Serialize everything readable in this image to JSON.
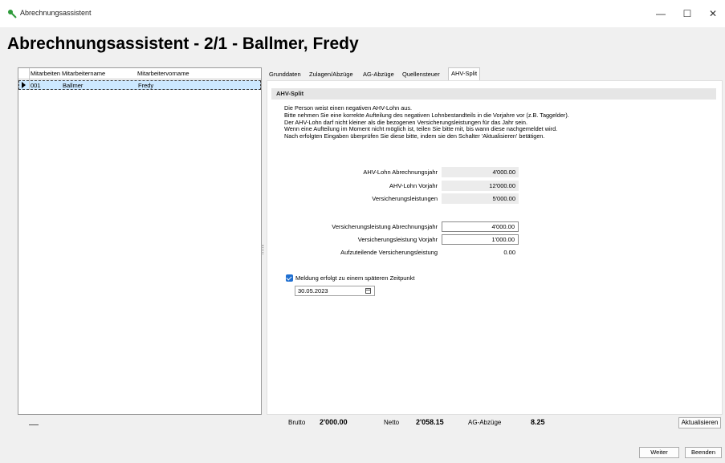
{
  "window": {
    "title": "Abrechnungsassistent",
    "controls": {
      "minimize": "—",
      "maximize": "☐",
      "close": "✕"
    }
  },
  "header": {
    "title": "Abrechnungsassistent - 2/1 - Ballmer, Fredy"
  },
  "employee_grid": {
    "columns": [
      "Mitarbeiten",
      "Mitarbeitername",
      "Mitarbeitervorname"
    ],
    "rows": [
      {
        "id": "001",
        "name": "Ballmer",
        "firstname": "Fredy"
      }
    ]
  },
  "tabs": [
    {
      "label": "Grunddaten"
    },
    {
      "label": "Zulagen/Abzüge"
    },
    {
      "label": "AG-Abzüge"
    },
    {
      "label": "Quellensteuer"
    },
    {
      "label": "AHV-Split",
      "active": true
    }
  ],
  "section": {
    "heading": "AHV-Split",
    "description": [
      "Die Person weist einen negativen AHV-Lohn aus.",
      "Bitte nehmen Sie eine korrekte Aufteilung des negativen Lohnbestandteils in die Vorjahre vor (z.B. Taggelder).",
      "Der AHV-Lohn darf nicht kleiner als die bezogenen Versicherungsleistungen für das Jahr sein.",
      "Wenn eine Aufteilung im Moment nicht möglich ist, teilen Sie bitte mit, bis wann diese nachgemeldet wird.",
      "Nach erfolgten Eingaben überprüfen Sie diese bitte, indem sie den Schalter 'Aktualisieren' betätigen."
    ]
  },
  "fields_readonly": [
    {
      "label": "AHV-Lohn Abrechnungsjahr",
      "value": "4'000.00"
    },
    {
      "label": "AHV-Lohn Vorjahr",
      "value": "12'000.00"
    },
    {
      "label": "Versicherungsleistungen",
      "value": "5'000.00"
    }
  ],
  "fields_input": [
    {
      "label": "Versicherungsleistung Abrechnungsjahr",
      "value": "4'000.00"
    },
    {
      "label": "Versicherungsleistung Vorjahr",
      "value": "1'000.00"
    }
  ],
  "field_result": {
    "label": "Aufzuteilende Versicherungsleistung",
    "value": "0.00"
  },
  "later_report": {
    "checkbox_label": "Meldung erfolgt zu einem späteren Zeitpunkt",
    "checked": true,
    "date": "30.05.2023"
  },
  "status": {
    "brutto_label": "Brutto",
    "brutto_value": "2'000.00",
    "netto_label": "Netto",
    "netto_value": "2'058.15",
    "ag_label": "AG-Abzüge",
    "ag_value": "8.25",
    "refresh_button": "Aktualisieren"
  },
  "footer": {
    "next_button": "Weiter",
    "finish_button": "Beenden"
  },
  "colors": {
    "selection": "#cce8ff",
    "checkbox": "#1f6fd1"
  }
}
